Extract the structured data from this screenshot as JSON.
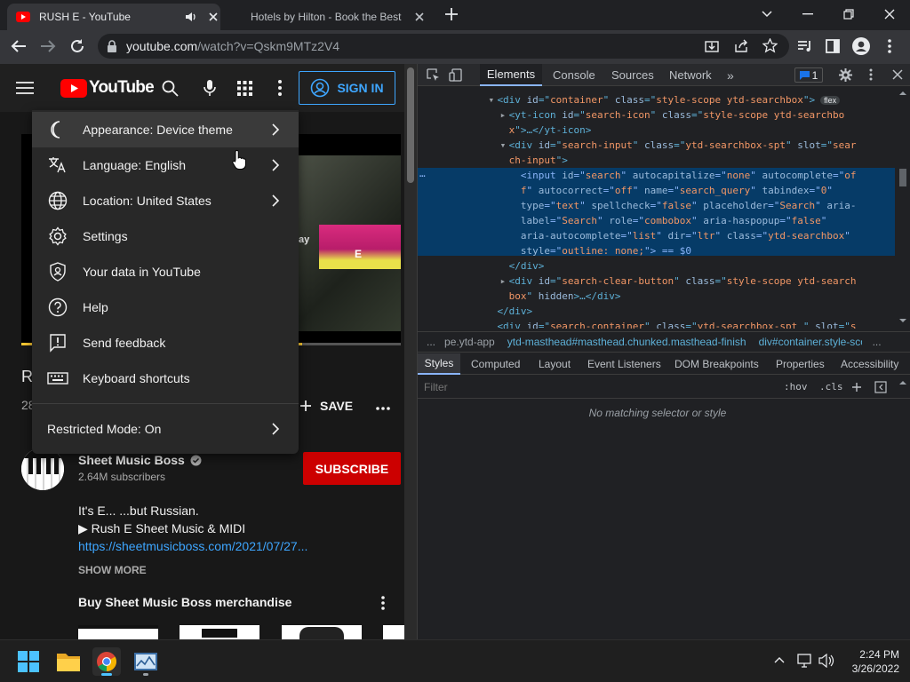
{
  "browser": {
    "tabs": [
      {
        "title": "RUSH E - YouTube",
        "active": true
      },
      {
        "title": "Hotels by Hilton - Book the Best",
        "active": false
      }
    ],
    "url_domain": "youtube.com",
    "url_path": "/watch?v=Qskm9MTz2V4"
  },
  "youtube": {
    "logo_text": "YouTube",
    "sign_in": "SIGN IN",
    "menu": {
      "items": [
        {
          "label": "Appearance: Device theme",
          "icon": "moon-icon",
          "chevron": true
        },
        {
          "label": "Language: English",
          "icon": "translate-icon",
          "chevron": true
        },
        {
          "label": "Location: United States",
          "icon": "globe-icon",
          "chevron": true
        },
        {
          "label": "Settings",
          "icon": "gear-icon",
          "chevron": false
        },
        {
          "label": "Your data in YouTube",
          "icon": "shield-person-icon",
          "chevron": false
        },
        {
          "label": "Help",
          "icon": "help-icon",
          "chevron": false
        },
        {
          "label": "Send feedback",
          "icon": "feedback-icon",
          "chevron": false
        },
        {
          "label": "Keyboard shortcuts",
          "icon": "keyboard-icon",
          "chevron": false
        }
      ],
      "restricted_mode": "Restricted Mode: On"
    },
    "title_initial": "R",
    "views_partial": "28",
    "save_label": "SAVE",
    "channel": {
      "name": "Sheet Music Boss",
      "subscribers": "2.64M subscribers",
      "subscribe_label": "SUBSCRIBE"
    },
    "description": {
      "line1": "It's E... ...but Russian.",
      "line2": "▶ Rush E Sheet Music & MIDI",
      "link": "https://sheetmusicboss.com/2021/07/27...",
      "show_more": "SHOW MORE"
    },
    "merch_heading": "Buy Sheet Music Boss merchandise",
    "video_overlay_text": "ay",
    "thumb_letter": "E"
  },
  "devtools": {
    "tabs": [
      "Elements",
      "Console",
      "Sources",
      "Network"
    ],
    "issues_count": "1",
    "code_lines": [
      {
        "indent": 12,
        "parts": [
          [
            "tg",
            "<div "
          ],
          [
            "an",
            "id"
          ],
          [
            "tg",
            "=\""
          ],
          [
            "av",
            "container"
          ],
          [
            "tg",
            "\" "
          ],
          [
            "an",
            "class"
          ],
          [
            "tg",
            "=\""
          ],
          [
            "av",
            "style-scope ytd-searchbox"
          ],
          [
            "tg",
            "\">"
          ]
        ],
        "badge": "flex",
        "arrow": "open"
      },
      {
        "indent": 14,
        "parts": [
          [
            "tg",
            "<yt-icon "
          ],
          [
            "an",
            "id"
          ],
          [
            "tg",
            "=\""
          ],
          [
            "av",
            "search-icon"
          ],
          [
            "tg",
            "\" "
          ],
          [
            "an",
            "class"
          ],
          [
            "tg",
            "=\""
          ],
          [
            "av",
            "style-scope ytd-searchbo"
          ]
        ],
        "arrow": "closed"
      },
      {
        "indent": 14,
        "parts": [
          [
            "av",
            "x"
          ],
          [
            "tg",
            "\">…</yt-icon>"
          ]
        ]
      },
      {
        "indent": 14,
        "parts": [
          [
            "tg",
            "<div "
          ],
          [
            "an",
            "id"
          ],
          [
            "tg",
            "=\""
          ],
          [
            "av",
            "search-input"
          ],
          [
            "tg",
            "\" "
          ],
          [
            "an",
            "class"
          ],
          [
            "tg",
            "=\""
          ],
          [
            "av",
            "ytd-searchbox-spt"
          ],
          [
            "tg",
            "\" "
          ],
          [
            "an",
            "slot"
          ],
          [
            "tg",
            "=\""
          ],
          [
            "av",
            "sear"
          ]
        ],
        "arrow": "open"
      },
      {
        "indent": 14,
        "parts": [
          [
            "av",
            "ch-input"
          ],
          [
            "tg",
            "\">"
          ]
        ]
      },
      {
        "indent": 16,
        "parts": [
          [
            "tg",
            "<input "
          ],
          [
            "an",
            "id"
          ],
          [
            "tg",
            "=\""
          ],
          [
            "av",
            "search"
          ],
          [
            "tg",
            "\" "
          ],
          [
            "an",
            "autocapitalize"
          ],
          [
            "tg",
            "=\""
          ],
          [
            "av",
            "none"
          ],
          [
            "tg",
            "\" "
          ],
          [
            "an",
            "autocomplete"
          ],
          [
            "tg",
            "=\""
          ],
          [
            "av",
            "of"
          ]
        ],
        "selected": true
      },
      {
        "indent": 16,
        "parts": [
          [
            "av",
            "f"
          ],
          [
            "tg",
            "\" "
          ],
          [
            "an",
            "autocorrect"
          ],
          [
            "tg",
            "=\""
          ],
          [
            "av",
            "off"
          ],
          [
            "tg",
            "\" "
          ],
          [
            "an",
            "name"
          ],
          [
            "tg",
            "=\""
          ],
          [
            "av",
            "search_query"
          ],
          [
            "tg",
            "\" "
          ],
          [
            "an",
            "tabindex"
          ],
          [
            "tg",
            "=\""
          ],
          [
            "av",
            "0"
          ],
          [
            "tg",
            "\""
          ]
        ],
        "selected": true
      },
      {
        "indent": 16,
        "parts": [
          [
            "an",
            "type"
          ],
          [
            "tg",
            "=\""
          ],
          [
            "av",
            "text"
          ],
          [
            "tg",
            "\" "
          ],
          [
            "an",
            "spellcheck"
          ],
          [
            "tg",
            "=\""
          ],
          [
            "av",
            "false"
          ],
          [
            "tg",
            "\" "
          ],
          [
            "an",
            "placeholder"
          ],
          [
            "tg",
            "=\""
          ],
          [
            "av",
            "Search"
          ],
          [
            "tg",
            "\" "
          ],
          [
            "an",
            "aria-"
          ]
        ],
        "selected": true
      },
      {
        "indent": 16,
        "parts": [
          [
            "an",
            "label"
          ],
          [
            "tg",
            "=\""
          ],
          [
            "av",
            "Search"
          ],
          [
            "tg",
            "\" "
          ],
          [
            "an",
            "role"
          ],
          [
            "tg",
            "=\""
          ],
          [
            "av",
            "combobox"
          ],
          [
            "tg",
            "\" "
          ],
          [
            "an",
            "aria-haspopup"
          ],
          [
            "tg",
            "=\""
          ],
          [
            "av",
            "false"
          ],
          [
            "tg",
            "\""
          ]
        ],
        "selected": true
      },
      {
        "indent": 16,
        "parts": [
          [
            "an",
            "aria-autocomplete"
          ],
          [
            "tg",
            "=\""
          ],
          [
            "av",
            "list"
          ],
          [
            "tg",
            "\" "
          ],
          [
            "an",
            "dir"
          ],
          [
            "tg",
            "=\""
          ],
          [
            "av",
            "ltr"
          ],
          [
            "tg",
            "\" "
          ],
          [
            "an",
            "class"
          ],
          [
            "tg",
            "=\""
          ],
          [
            "av",
            "ytd-searchbox"
          ],
          [
            "tg",
            "\""
          ]
        ],
        "selected": true
      },
      {
        "indent": 16,
        "parts": [
          [
            "an",
            "style"
          ],
          [
            "tg",
            "=\""
          ],
          [
            "av",
            "outline: none;"
          ],
          [
            "tg",
            "\"> == $0"
          ]
        ],
        "selected": true
      },
      {
        "indent": 14,
        "parts": [
          [
            "tg",
            "</div>"
          ]
        ]
      },
      {
        "indent": 14,
        "parts": [
          [
            "tg",
            "<div "
          ],
          [
            "an",
            "id"
          ],
          [
            "tg",
            "=\""
          ],
          [
            "av",
            "search-clear-button"
          ],
          [
            "tg",
            "\" "
          ],
          [
            "an",
            "class"
          ],
          [
            "tg",
            "=\""
          ],
          [
            "av",
            "style-scope ytd-search"
          ]
        ],
        "arrow": "closed"
      },
      {
        "indent": 14,
        "parts": [
          [
            "av",
            "box"
          ],
          [
            "tg",
            "\" "
          ],
          [
            "an",
            "hidden"
          ],
          [
            "tg",
            ">…</div>"
          ]
        ]
      },
      {
        "indent": 12,
        "parts": [
          [
            "tg",
            "</div>"
          ]
        ]
      },
      {
        "indent": 12,
        "parts": [
          [
            "tg",
            "<div "
          ],
          [
            "an",
            "id"
          ],
          [
            "tg",
            "=\""
          ],
          [
            "av",
            "search-container"
          ],
          [
            "tg",
            "\" "
          ],
          [
            "an",
            "class"
          ],
          [
            "tg",
            "=\""
          ],
          [
            "av",
            "ytd-searchbox-spt "
          ],
          [
            "tg",
            "\" "
          ],
          [
            "an",
            "slot"
          ],
          [
            "tg",
            "=\""
          ],
          [
            "av",
            "s"
          ]
        ]
      }
    ],
    "breadcrumbs": [
      "...",
      "pe.ytd-app",
      "ytd-masthead#masthead.chunked.masthead-finish",
      "div#container.style-scope.y",
      "..."
    ],
    "styles_tabs": [
      "Styles",
      "Computed",
      "Layout",
      "Event Listeners",
      "DOM Breakpoints",
      "Properties",
      "Accessibility"
    ],
    "filter_placeholder": "Filter",
    "hov": ":hov",
    "cls": ".cls",
    "no_match": "No matching selector or style"
  },
  "taskbar": {
    "time": "2:24 PM",
    "date": "3/26/2022"
  },
  "colors": {
    "accent_blue": "#3ea6ff",
    "youtube_red": "#ff0000",
    "subscribe_red": "#cc0000",
    "selection": "#063b67"
  }
}
